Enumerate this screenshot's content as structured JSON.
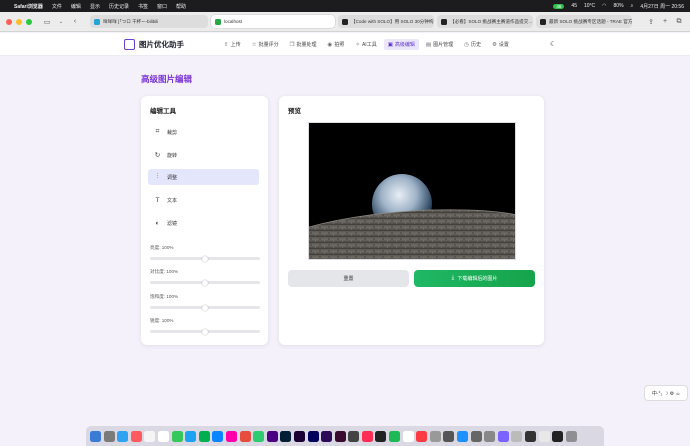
{
  "menubar": {
    "app_name": "Safari浏览器",
    "items": [
      "文件",
      "编辑",
      "显示",
      "历史记录",
      "书签",
      "窗口",
      "帮助"
    ],
    "status_badge": "46",
    "cpu_badge": "45",
    "temp": "10°C",
    "battery": "80%",
    "datetime": "4月27日 周一  20:56"
  },
  "browser": {
    "tabs": [
      {
        "label": "咩咩咩 [「つロ 干杯~--bilibili",
        "active": false,
        "color": "#23a6d5"
      },
      {
        "label": "localhost",
        "active": true,
        "color": "#28a745"
      },
      {
        "label": "【Code with SOLO】用 SOLO 30分钟构...",
        "active": false,
        "color": "#222222"
      },
      {
        "label": "【必看】SOLO 挑战赛主赛道作品提交...",
        "active": false,
        "color": "#222222"
      },
      {
        "label": "最新 SOLO 挑战赛专区话题 - TRAE 官方...",
        "active": false,
        "color": "#222222"
      }
    ]
  },
  "app": {
    "brand": "图片优化助手",
    "nav": [
      {
        "label": "上传",
        "icon": "upload-icon",
        "glyph": "⇧",
        "active": false
      },
      {
        "label": "批量评分",
        "icon": "star-icon",
        "glyph": "☆",
        "active": false
      },
      {
        "label": "批量处理",
        "icon": "layers-icon",
        "glyph": "❐",
        "active": false
      },
      {
        "label": "拍照",
        "icon": "camera-icon",
        "glyph": "◉",
        "active": false
      },
      {
        "label": "AI工具",
        "icon": "sparkle-icon",
        "glyph": "✧",
        "active": false
      },
      {
        "label": "高级编辑",
        "icon": "edit-image-icon",
        "glyph": "▣",
        "active": true
      },
      {
        "label": "图片管理",
        "icon": "image-icon",
        "glyph": "▤",
        "active": false
      },
      {
        "label": "历史",
        "icon": "clock-icon",
        "glyph": "◷",
        "active": false
      },
      {
        "label": "设置",
        "icon": "gear-icon",
        "glyph": "⚙",
        "active": false
      }
    ]
  },
  "page": {
    "title": "高级图片编辑",
    "tools_title": "编辑工具",
    "tools": [
      {
        "label": "裁剪",
        "icon": "crop-icon",
        "glyph": "⌗",
        "active": false
      },
      {
        "label": "旋转",
        "icon": "rotate-icon",
        "glyph": "↻",
        "active": false
      },
      {
        "label": "调整",
        "icon": "sliders-icon",
        "glyph": "⫶",
        "active": true
      },
      {
        "label": "文本",
        "icon": "text-icon",
        "glyph": "T",
        "active": false
      },
      {
        "label": "滤镜",
        "icon": "palette-icon",
        "glyph": "◐",
        "active": false
      }
    ],
    "sliders": [
      {
        "label": "亮度: 100%",
        "value": 0.5
      },
      {
        "label": "对比度: 100%",
        "value": 0.5
      },
      {
        "label": "饱和度: 100%",
        "value": 0.5
      },
      {
        "label": "锐度: 100%",
        "value": 0.5
      }
    ],
    "preview_title": "预览",
    "reset_label": "重置",
    "download_label": "下载编辑后的图片"
  },
  "widget": {
    "text": "中·°₂ ☽ ⚙ ☕"
  },
  "colors": {
    "accent": "#7a35d6",
    "download": "#16a34a",
    "active_tool": "#e4e6fb"
  }
}
